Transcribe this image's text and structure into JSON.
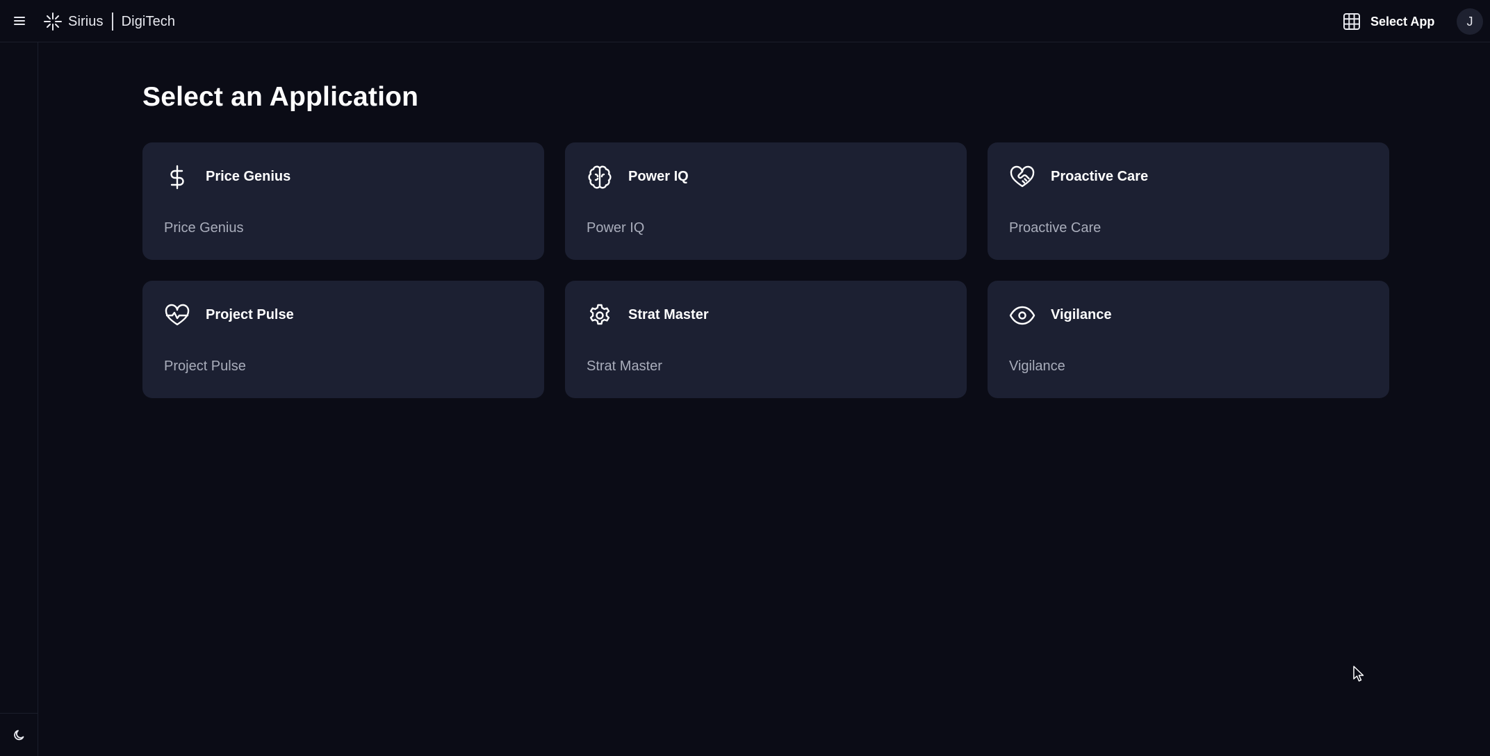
{
  "header": {
    "brand_name": "Sirius",
    "brand_suffix": "DigiTech",
    "select_app_label": "Select App",
    "avatar_initial": "J"
  },
  "main": {
    "title": "Select an Application",
    "apps": [
      {
        "title": "Price Genius",
        "description": "Price Genius",
        "icon": "dollar-icon"
      },
      {
        "title": "Power IQ",
        "description": "Power IQ",
        "icon": "brain-icon"
      },
      {
        "title": "Proactive Care",
        "description": "Proactive Care",
        "icon": "heart-handshake-icon"
      },
      {
        "title": "Project Pulse",
        "description": "Project Pulse",
        "icon": "heart-pulse-icon"
      },
      {
        "title": "Strat Master",
        "description": "Strat Master",
        "icon": "gear-icon"
      },
      {
        "title": "Vigilance",
        "description": "Vigilance",
        "icon": "eye-icon"
      }
    ]
  },
  "sidebar": {
    "theme_toggle_icon": "moon-icon"
  },
  "colors": {
    "background": "#0b0c16",
    "card": "#1c2032",
    "text_primary": "#ffffff",
    "text_secondary": "#a9adbb",
    "border": "#1b1e2b"
  }
}
